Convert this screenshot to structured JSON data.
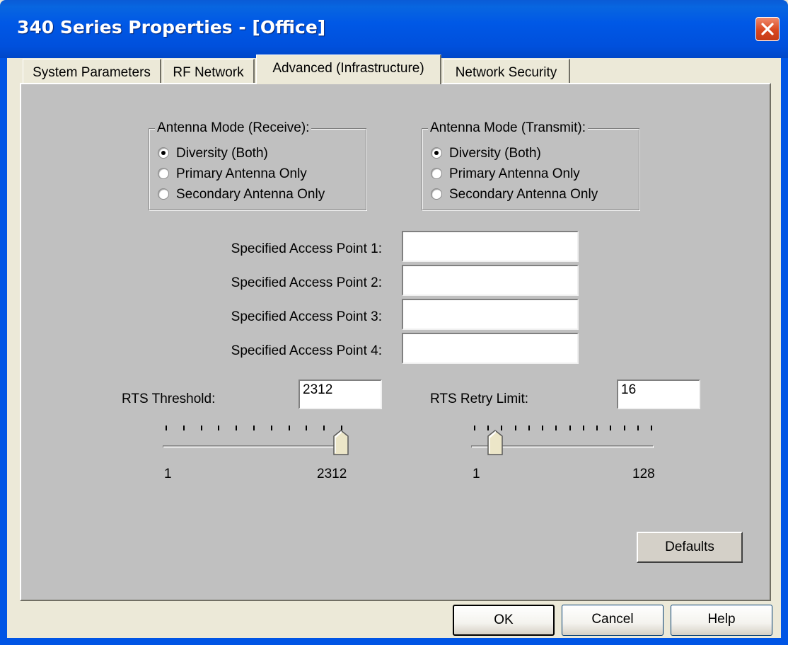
{
  "window": {
    "title": "340 Series Properties - [Office]"
  },
  "tabs": [
    {
      "label": "System Parameters",
      "active": false
    },
    {
      "label": "RF Network",
      "active": false
    },
    {
      "label": "Advanced (Infrastructure)",
      "active": true
    },
    {
      "label": "Network Security",
      "active": false
    }
  ],
  "antenna_receive": {
    "title": "Antenna Mode (Receive):",
    "options": [
      "Diversity (Both)",
      "Primary Antenna Only",
      "Secondary Antenna Only"
    ],
    "selected": "Diversity (Both)"
  },
  "antenna_transmit": {
    "title": "Antenna Mode (Transmit):",
    "options": [
      "Diversity (Both)",
      "Primary Antenna Only",
      "Secondary Antenna Only"
    ],
    "selected": "Diversity (Both)"
  },
  "access_points": [
    {
      "label": "Specified Access Point 1:",
      "value": ""
    },
    {
      "label": "Specified Access Point 2:",
      "value": ""
    },
    {
      "label": "Specified Access Point 3:",
      "value": ""
    },
    {
      "label": "Specified Access Point 4:",
      "value": ""
    }
  ],
  "rts_threshold": {
    "label": "RTS Threshold:",
    "value": "2312",
    "min_label": "1",
    "max_label": "2312",
    "min": 1,
    "max": 2312,
    "slider_value": 2312
  },
  "rts_retry": {
    "label": "RTS Retry Limit:",
    "value": "16",
    "min_label": "1",
    "max_label": "128",
    "min": 1,
    "max": 128,
    "slider_value": 16
  },
  "buttons": {
    "defaults": "Defaults",
    "ok": "OK",
    "cancel": "Cancel",
    "help": "Help"
  },
  "colors": {
    "titlebar": "#0055e5",
    "panel": "#c0c0c0",
    "window_face": "#ece9d8",
    "close_button": "#d9471f"
  }
}
